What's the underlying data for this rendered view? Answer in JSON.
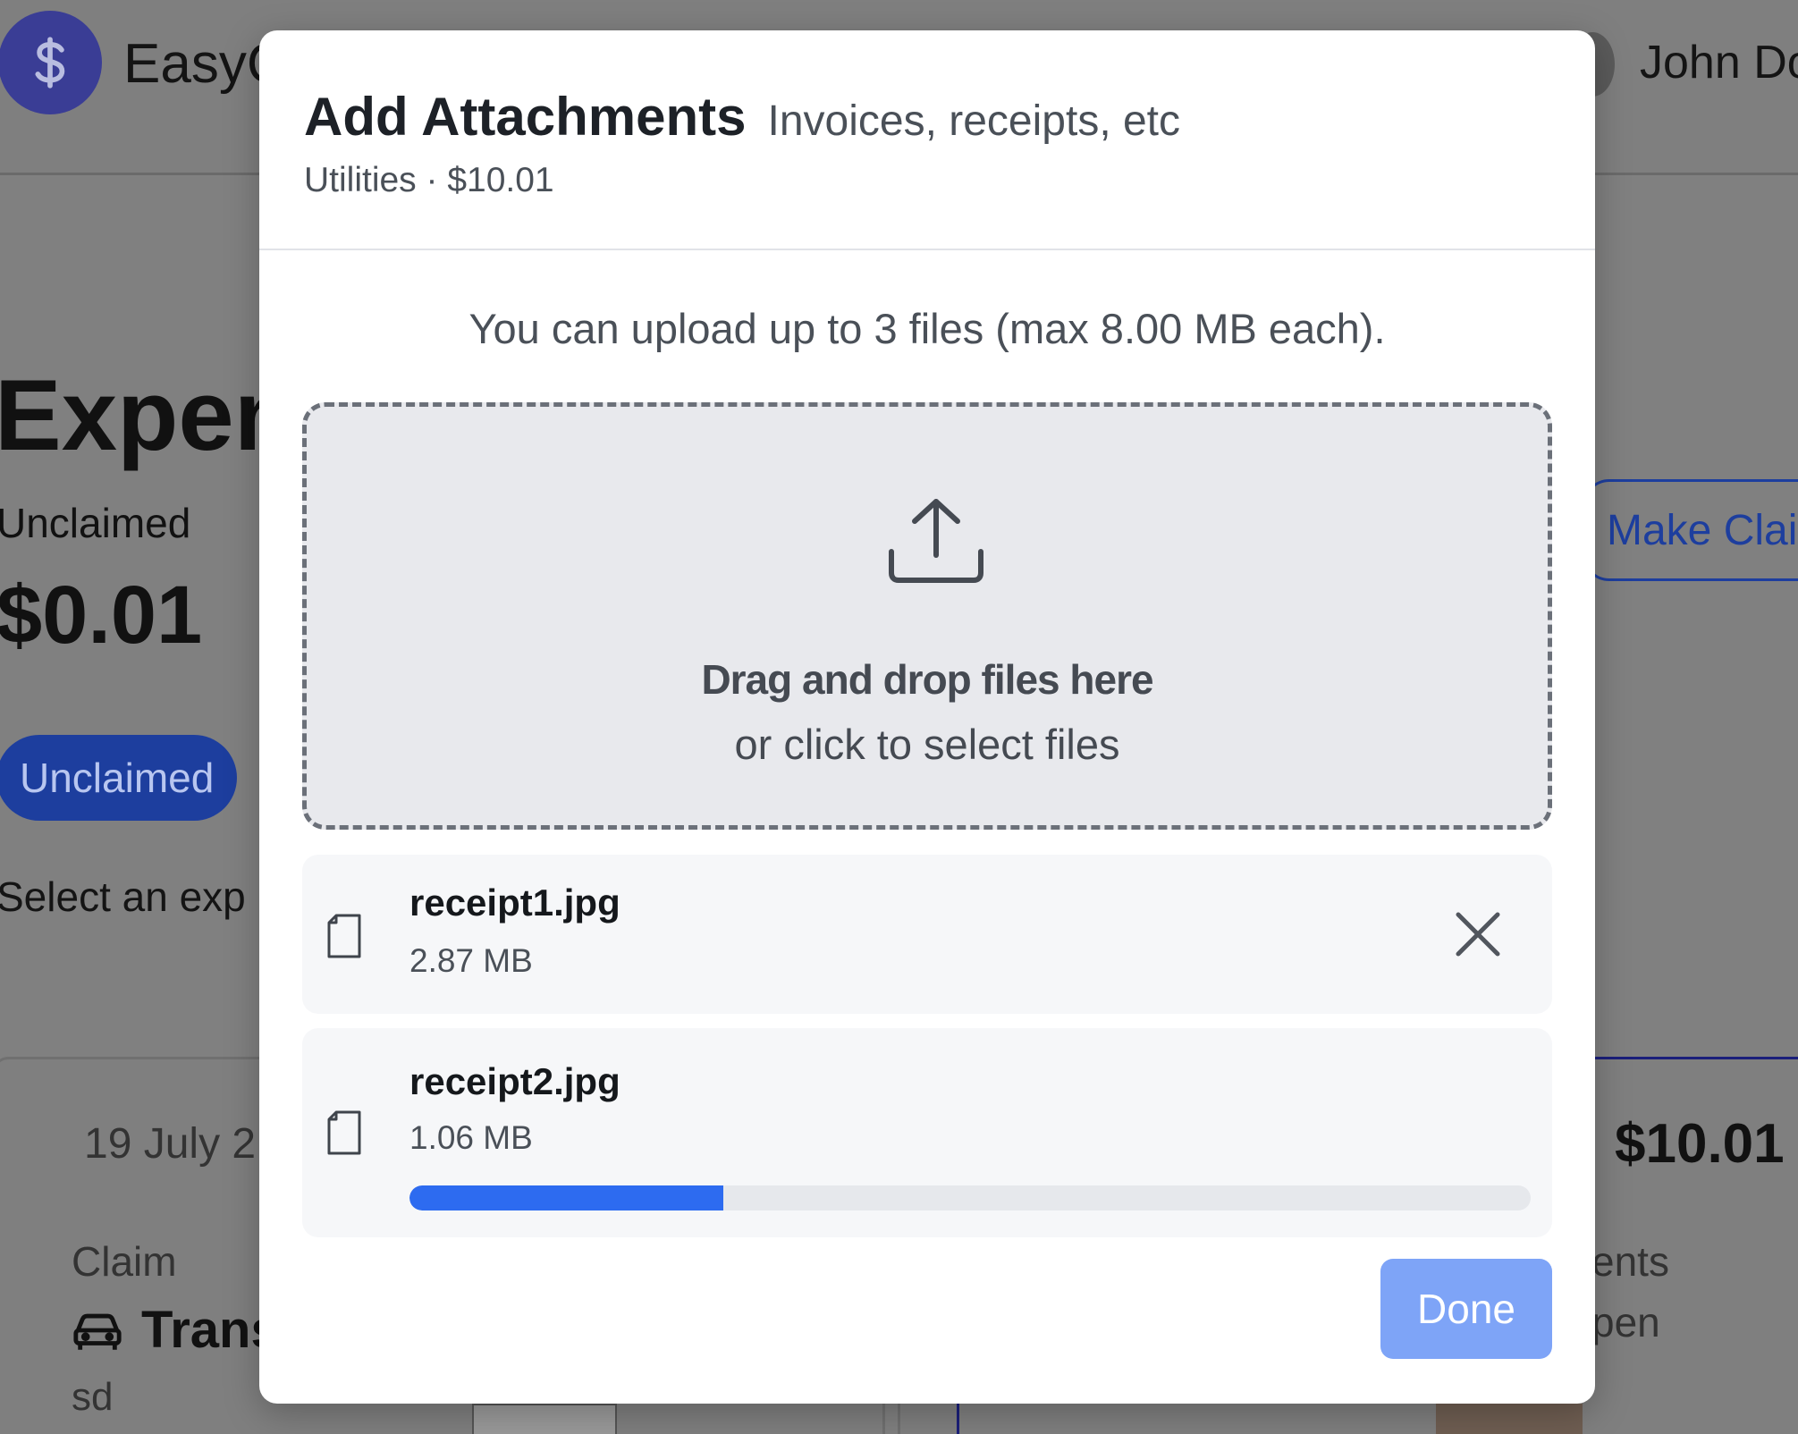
{
  "app": {
    "name": "EasyC",
    "user_name": "John Do"
  },
  "background": {
    "page_title": "Expen",
    "unclaimed_label": "Unclaimed",
    "unclaimed_amount": "$0.01",
    "unclaimed_pill": "Unclaimed",
    "select_hint": "Select an exp",
    "make_claim_button": "Make Clair",
    "card_left": {
      "date": "19 July 2",
      "claim_label": "Claim",
      "claim_value": "Trans",
      "note": "sd"
    },
    "card_right": {
      "amount": "$10.01",
      "attachments_label": "ents",
      "open_text": "pen"
    }
  },
  "modal": {
    "title": "Add Attachments",
    "subtitle": "Invoices, receipts, etc",
    "meta": "Utilities · $10.01",
    "upload_limit": "You can upload up to 3 files (max 8.00 MB each).",
    "dropzone": {
      "icon": "upload-icon",
      "title": "Drag and drop files here",
      "subtitle": "or click to select files"
    },
    "files": [
      {
        "name": "receipt1.jpg",
        "size": "2.87 MB",
        "icon": "file-icon",
        "status": "uploaded"
      },
      {
        "name": "receipt2.jpg",
        "size": "1.06 MB",
        "icon": "file-icon",
        "status": "uploading",
        "progress": 0.28
      }
    ],
    "done_button": "Done"
  },
  "colors": {
    "accent": "#2d6bf0",
    "done_button_disabled": "#7ea4f7",
    "overlay": "#808080",
    "brand": "#3a3d95"
  }
}
